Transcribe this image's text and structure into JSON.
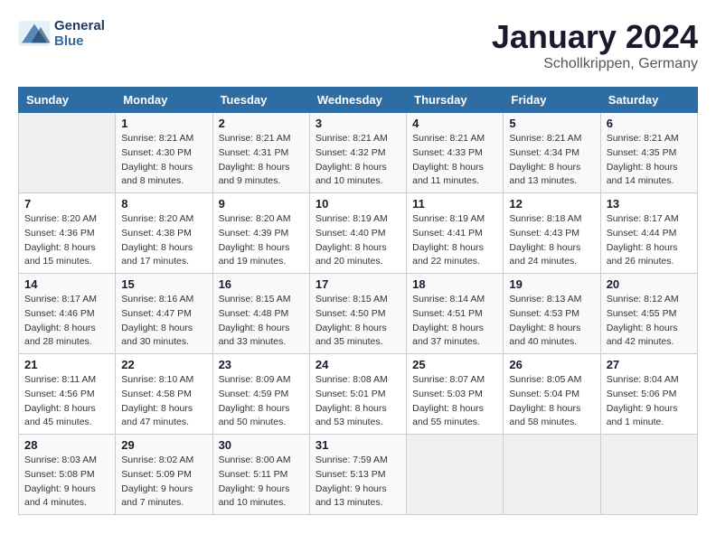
{
  "header": {
    "logo_line1": "General",
    "logo_line2": "Blue",
    "title": "January 2024",
    "subtitle": "Schollkrippen, Germany"
  },
  "columns": [
    "Sunday",
    "Monday",
    "Tuesday",
    "Wednesday",
    "Thursday",
    "Friday",
    "Saturday"
  ],
  "weeks": [
    [
      {
        "day": "",
        "empty": true
      },
      {
        "day": "1",
        "sunrise": "Sunrise: 8:21 AM",
        "sunset": "Sunset: 4:30 PM",
        "daylight": "Daylight: 8 hours and 8 minutes."
      },
      {
        "day": "2",
        "sunrise": "Sunrise: 8:21 AM",
        "sunset": "Sunset: 4:31 PM",
        "daylight": "Daylight: 8 hours and 9 minutes."
      },
      {
        "day": "3",
        "sunrise": "Sunrise: 8:21 AM",
        "sunset": "Sunset: 4:32 PM",
        "daylight": "Daylight: 8 hours and 10 minutes."
      },
      {
        "day": "4",
        "sunrise": "Sunrise: 8:21 AM",
        "sunset": "Sunset: 4:33 PM",
        "daylight": "Daylight: 8 hours and 11 minutes."
      },
      {
        "day": "5",
        "sunrise": "Sunrise: 8:21 AM",
        "sunset": "Sunset: 4:34 PM",
        "daylight": "Daylight: 8 hours and 13 minutes."
      },
      {
        "day": "6",
        "sunrise": "Sunrise: 8:21 AM",
        "sunset": "Sunset: 4:35 PM",
        "daylight": "Daylight: 8 hours and 14 minutes."
      }
    ],
    [
      {
        "day": "7",
        "sunrise": "Sunrise: 8:20 AM",
        "sunset": "Sunset: 4:36 PM",
        "daylight": "Daylight: 8 hours and 15 minutes."
      },
      {
        "day": "8",
        "sunrise": "Sunrise: 8:20 AM",
        "sunset": "Sunset: 4:38 PM",
        "daylight": "Daylight: 8 hours and 17 minutes."
      },
      {
        "day": "9",
        "sunrise": "Sunrise: 8:20 AM",
        "sunset": "Sunset: 4:39 PM",
        "daylight": "Daylight: 8 hours and 19 minutes."
      },
      {
        "day": "10",
        "sunrise": "Sunrise: 8:19 AM",
        "sunset": "Sunset: 4:40 PM",
        "daylight": "Daylight: 8 hours and 20 minutes."
      },
      {
        "day": "11",
        "sunrise": "Sunrise: 8:19 AM",
        "sunset": "Sunset: 4:41 PM",
        "daylight": "Daylight: 8 hours and 22 minutes."
      },
      {
        "day": "12",
        "sunrise": "Sunrise: 8:18 AM",
        "sunset": "Sunset: 4:43 PM",
        "daylight": "Daylight: 8 hours and 24 minutes."
      },
      {
        "day": "13",
        "sunrise": "Sunrise: 8:17 AM",
        "sunset": "Sunset: 4:44 PM",
        "daylight": "Daylight: 8 hours and 26 minutes."
      }
    ],
    [
      {
        "day": "14",
        "sunrise": "Sunrise: 8:17 AM",
        "sunset": "Sunset: 4:46 PM",
        "daylight": "Daylight: 8 hours and 28 minutes."
      },
      {
        "day": "15",
        "sunrise": "Sunrise: 8:16 AM",
        "sunset": "Sunset: 4:47 PM",
        "daylight": "Daylight: 8 hours and 30 minutes."
      },
      {
        "day": "16",
        "sunrise": "Sunrise: 8:15 AM",
        "sunset": "Sunset: 4:48 PM",
        "daylight": "Daylight: 8 hours and 33 minutes."
      },
      {
        "day": "17",
        "sunrise": "Sunrise: 8:15 AM",
        "sunset": "Sunset: 4:50 PM",
        "daylight": "Daylight: 8 hours and 35 minutes."
      },
      {
        "day": "18",
        "sunrise": "Sunrise: 8:14 AM",
        "sunset": "Sunset: 4:51 PM",
        "daylight": "Daylight: 8 hours and 37 minutes."
      },
      {
        "day": "19",
        "sunrise": "Sunrise: 8:13 AM",
        "sunset": "Sunset: 4:53 PM",
        "daylight": "Daylight: 8 hours and 40 minutes."
      },
      {
        "day": "20",
        "sunrise": "Sunrise: 8:12 AM",
        "sunset": "Sunset: 4:55 PM",
        "daylight": "Daylight: 8 hours and 42 minutes."
      }
    ],
    [
      {
        "day": "21",
        "sunrise": "Sunrise: 8:11 AM",
        "sunset": "Sunset: 4:56 PM",
        "daylight": "Daylight: 8 hours and 45 minutes."
      },
      {
        "day": "22",
        "sunrise": "Sunrise: 8:10 AM",
        "sunset": "Sunset: 4:58 PM",
        "daylight": "Daylight: 8 hours and 47 minutes."
      },
      {
        "day": "23",
        "sunrise": "Sunrise: 8:09 AM",
        "sunset": "Sunset: 4:59 PM",
        "daylight": "Daylight: 8 hours and 50 minutes."
      },
      {
        "day": "24",
        "sunrise": "Sunrise: 8:08 AM",
        "sunset": "Sunset: 5:01 PM",
        "daylight": "Daylight: 8 hours and 53 minutes."
      },
      {
        "day": "25",
        "sunrise": "Sunrise: 8:07 AM",
        "sunset": "Sunset: 5:03 PM",
        "daylight": "Daylight: 8 hours and 55 minutes."
      },
      {
        "day": "26",
        "sunrise": "Sunrise: 8:05 AM",
        "sunset": "Sunset: 5:04 PM",
        "daylight": "Daylight: 8 hours and 58 minutes."
      },
      {
        "day": "27",
        "sunrise": "Sunrise: 8:04 AM",
        "sunset": "Sunset: 5:06 PM",
        "daylight": "Daylight: 9 hours and 1 minute."
      }
    ],
    [
      {
        "day": "28",
        "sunrise": "Sunrise: 8:03 AM",
        "sunset": "Sunset: 5:08 PM",
        "daylight": "Daylight: 9 hours and 4 minutes."
      },
      {
        "day": "29",
        "sunrise": "Sunrise: 8:02 AM",
        "sunset": "Sunset: 5:09 PM",
        "daylight": "Daylight: 9 hours and 7 minutes."
      },
      {
        "day": "30",
        "sunrise": "Sunrise: 8:00 AM",
        "sunset": "Sunset: 5:11 PM",
        "daylight": "Daylight: 9 hours and 10 minutes."
      },
      {
        "day": "31",
        "sunrise": "Sunrise: 7:59 AM",
        "sunset": "Sunset: 5:13 PM",
        "daylight": "Daylight: 9 hours and 13 minutes."
      },
      {
        "day": "",
        "empty": true
      },
      {
        "day": "",
        "empty": true
      },
      {
        "day": "",
        "empty": true
      }
    ]
  ]
}
